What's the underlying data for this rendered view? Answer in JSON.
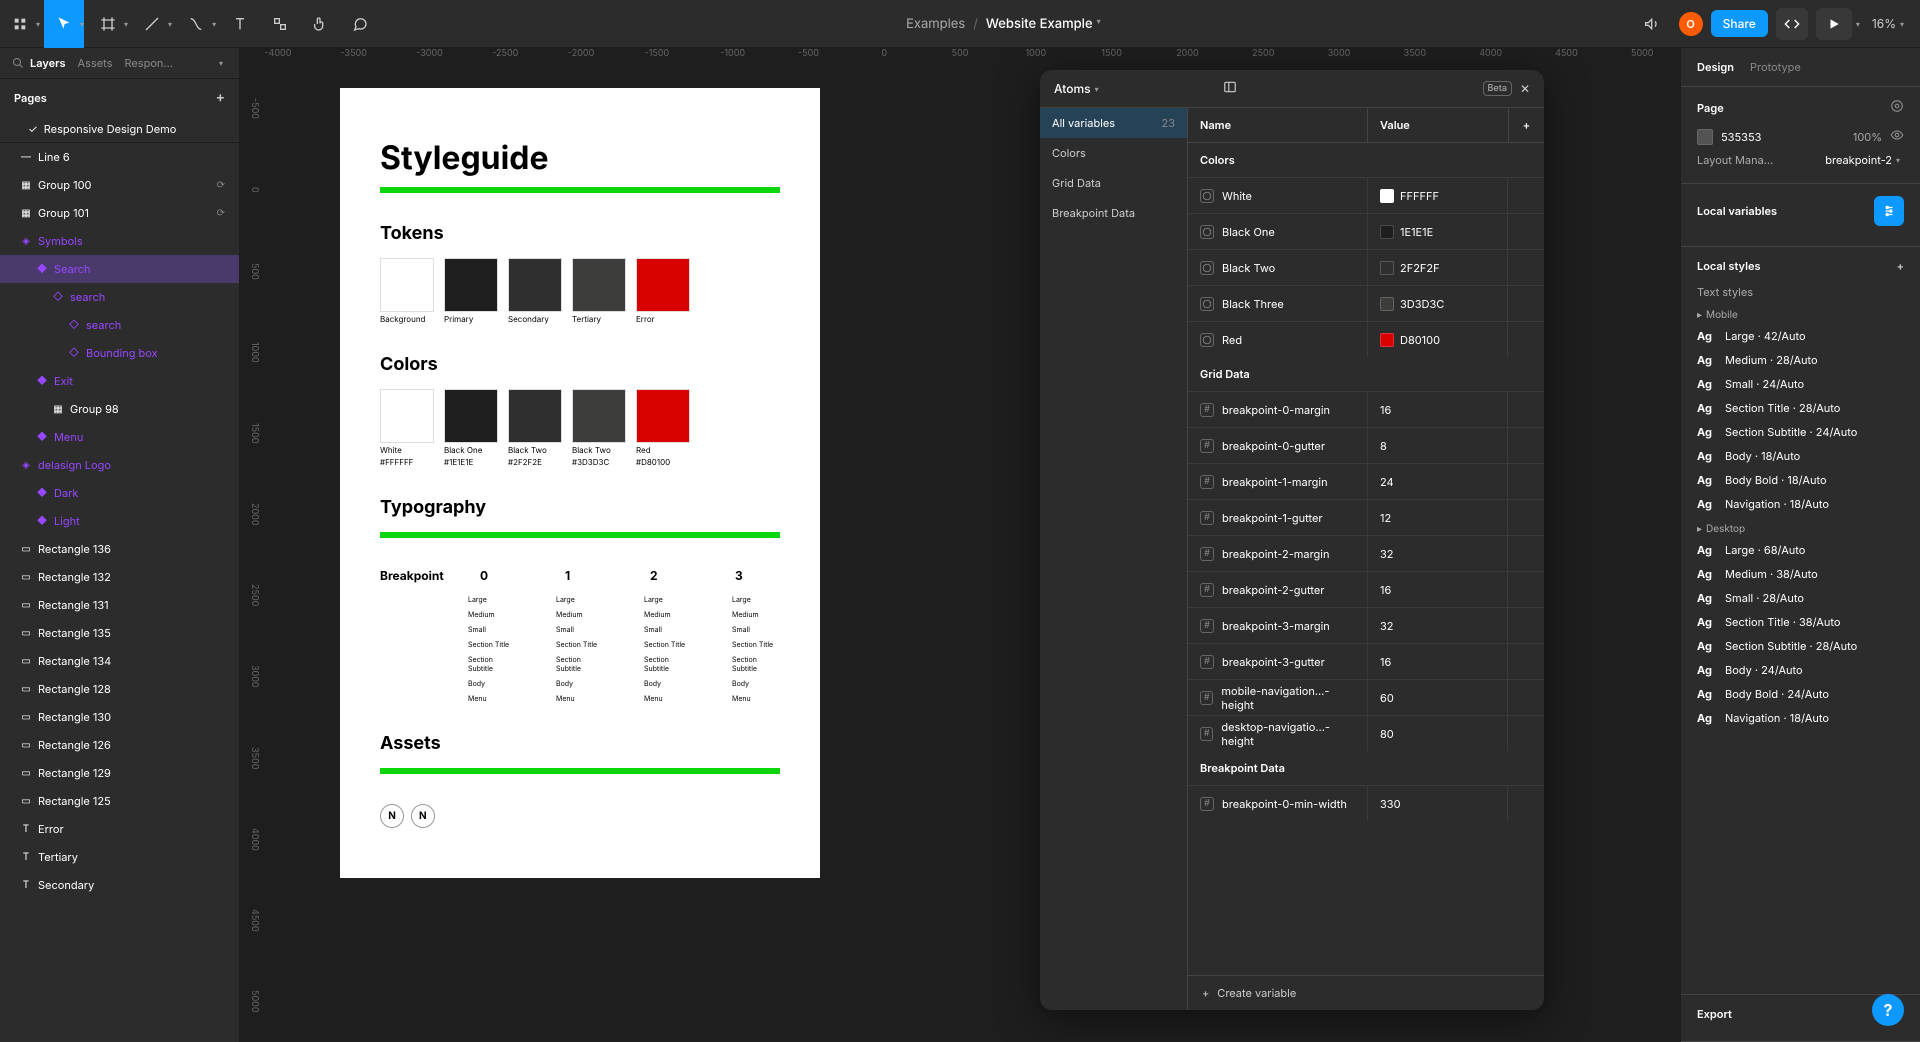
{
  "toolbar": {
    "breadcrumb_project": "Examples",
    "breadcrumb_file": "Website Example",
    "share": "Share",
    "avatar_initial": "O",
    "zoom": "16%"
  },
  "rulers": {
    "h": [
      "-4000",
      "-3500",
      "-3000",
      "-2500",
      "-2000",
      "-1500",
      "-1000",
      "-500",
      "0",
      "500",
      "1000",
      "1500",
      "2000",
      "2500",
      "3000",
      "3500",
      "4000",
      "4500",
      "5000"
    ],
    "v": [
      "-500",
      "0",
      "500",
      "1000",
      "1500",
      "2000",
      "2500",
      "3000",
      "3500",
      "4000",
      "4500",
      "5000"
    ]
  },
  "left_panel": {
    "tabs": [
      "Layers",
      "Assets",
      "Respon…"
    ],
    "active_tab": 0,
    "pages_label": "Pages",
    "active_page": "Responsive Design Demo",
    "layers": [
      {
        "indent": 0,
        "kind": "line",
        "label": "Line 6"
      },
      {
        "indent": 0,
        "kind": "group",
        "label": "Group 100",
        "badge": "⟳"
      },
      {
        "indent": 0,
        "kind": "group",
        "label": "Group 101",
        "badge": "⟳"
      },
      {
        "indent": 0,
        "kind": "comp-set",
        "label": "Symbols",
        "comp": true
      },
      {
        "indent": 1,
        "kind": "comp",
        "label": "Search",
        "comp": true,
        "selected": true
      },
      {
        "indent": 2,
        "kind": "instance",
        "label": "search",
        "comp": true
      },
      {
        "indent": 3,
        "kind": "instance",
        "label": "search",
        "comp": true
      },
      {
        "indent": 3,
        "kind": "instance",
        "label": "Bounding box",
        "comp": true
      },
      {
        "indent": 1,
        "kind": "comp",
        "label": "Exit",
        "comp": true
      },
      {
        "indent": 2,
        "kind": "group",
        "label": "Group 98"
      },
      {
        "indent": 1,
        "kind": "comp",
        "label": "Menu",
        "comp": true
      },
      {
        "indent": 0,
        "kind": "comp-set",
        "label": "delasign Logo",
        "comp": true
      },
      {
        "indent": 1,
        "kind": "comp",
        "label": "Dark",
        "comp": true
      },
      {
        "indent": 1,
        "kind": "comp",
        "label": "Light",
        "comp": true
      },
      {
        "indent": 0,
        "kind": "rect",
        "label": "Rectangle 136"
      },
      {
        "indent": 0,
        "kind": "rect",
        "label": "Rectangle 132"
      },
      {
        "indent": 0,
        "kind": "rect",
        "label": "Rectangle 131"
      },
      {
        "indent": 0,
        "kind": "rect",
        "label": "Rectangle 135"
      },
      {
        "indent": 0,
        "kind": "rect",
        "label": "Rectangle 134"
      },
      {
        "indent": 0,
        "kind": "rect",
        "label": "Rectangle 128"
      },
      {
        "indent": 0,
        "kind": "rect",
        "label": "Rectangle 130"
      },
      {
        "indent": 0,
        "kind": "rect",
        "label": "Rectangle 126"
      },
      {
        "indent": 0,
        "kind": "rect",
        "label": "Rectangle 129"
      },
      {
        "indent": 0,
        "kind": "rect",
        "label": "Rectangle 125"
      },
      {
        "indent": 0,
        "kind": "text",
        "label": "Error"
      },
      {
        "indent": 0,
        "kind": "text",
        "label": "Tertiary"
      },
      {
        "indent": 0,
        "kind": "text",
        "label": "Secondary"
      }
    ]
  },
  "artboard": {
    "title": "Styleguide",
    "tokens_h": "Tokens",
    "token_swatches": [
      {
        "color": "#ffffff",
        "label": "Background"
      },
      {
        "color": "#1e1e1e",
        "label": "Primary"
      },
      {
        "color": "#2f2f2f",
        "label": "Secondary"
      },
      {
        "color": "#3d3d3c",
        "label": "Tertiary"
      },
      {
        "color": "#d80100",
        "label": "Error"
      }
    ],
    "colors_h": "Colors",
    "color_swatches": [
      {
        "color": "#ffffff",
        "label": "White",
        "sub": "#FFFFFF"
      },
      {
        "color": "#1e1e1e",
        "label": "Black One",
        "sub": "#1E1E1E"
      },
      {
        "color": "#2f2f2f",
        "label": "Black Two",
        "sub": "#2F2F2E"
      },
      {
        "color": "#3d3d3c",
        "label": "Black Two",
        "sub": "#3D3D3C"
      },
      {
        "color": "#d80100",
        "label": "Red",
        "sub": "#D80100"
      }
    ],
    "typo_h": "Typography",
    "typo_header": [
      "Breakpoint",
      "0",
      "1",
      "2",
      "3"
    ],
    "typo_rows": [
      [
        "",
        "Large",
        "Large",
        "Large",
        "Large"
      ],
      [
        "",
        "Medium",
        "Medium",
        "Medium",
        "Medium"
      ],
      [
        "",
        "Small",
        "Small",
        "Small",
        "Small"
      ],
      [
        "",
        "Section Title",
        "Section Title",
        "Section Title",
        "Section Title"
      ],
      [
        "",
        "Section Subtitle",
        "Section Subtitle",
        "Section Subtitle",
        "Section Subtitle"
      ],
      [
        "",
        "Body",
        "Body",
        "Body",
        "Body"
      ],
      [
        "",
        "Menu",
        "Menu",
        "Menu",
        "Menu"
      ]
    ],
    "assets_h": "Assets"
  },
  "vars_panel": {
    "title": "Atoms",
    "beta": "Beta",
    "sidebar": [
      {
        "label": "All variables",
        "count": "23",
        "active": true
      },
      {
        "label": "Colors"
      },
      {
        "label": "Grid Data"
      },
      {
        "label": "Breakpoint Data"
      }
    ],
    "col_name": "Name",
    "col_value": "Value",
    "groups": [
      {
        "title": "Colors",
        "rows": [
          {
            "type": "color",
            "name": "White",
            "value": "FFFFFF",
            "swatch": "#ffffff"
          },
          {
            "type": "color",
            "name": "Black One",
            "value": "1E1E1E",
            "swatch": "#1e1e1e"
          },
          {
            "type": "color",
            "name": "Black Two",
            "value": "2F2F2F",
            "swatch": "#2f2f2f"
          },
          {
            "type": "color",
            "name": "Black Three",
            "value": "3D3D3C",
            "swatch": "#3d3d3c"
          },
          {
            "type": "color",
            "name": "Red",
            "value": "D80100",
            "swatch": "#d80100"
          }
        ]
      },
      {
        "title": "Grid Data",
        "rows": [
          {
            "type": "number",
            "name": "breakpoint-0-margin",
            "value": "16"
          },
          {
            "type": "number",
            "name": "breakpoint-0-gutter",
            "value": "8"
          },
          {
            "type": "number",
            "name": "breakpoint-1-margin",
            "value": "24"
          },
          {
            "type": "number",
            "name": "breakpoint-1-gutter",
            "value": "12"
          },
          {
            "type": "number",
            "name": "breakpoint-2-margin",
            "value": "32"
          },
          {
            "type": "number",
            "name": "breakpoint-2-gutter",
            "value": "16"
          },
          {
            "type": "number",
            "name": "breakpoint-3-margin",
            "value": "32"
          },
          {
            "type": "number",
            "name": "breakpoint-3-gutter",
            "value": "16"
          },
          {
            "type": "number",
            "name": "mobile-navigation…-height",
            "value": "60"
          },
          {
            "type": "number",
            "name": "desktop-navigatio…-height",
            "value": "80"
          }
        ]
      },
      {
        "title": "Breakpoint Data",
        "rows": [
          {
            "type": "number",
            "name": "breakpoint-0-min-width",
            "value": "330"
          }
        ]
      }
    ],
    "footer": "Create variable"
  },
  "right_panel": {
    "tabs": [
      "Design",
      "Prototype"
    ],
    "page_label": "Page",
    "bg_hex": "535353",
    "bg_opacity": "100%",
    "layout_label": "Layout Mana…",
    "layout_value": "breakpoint-2",
    "local_vars": "Local variables",
    "local_styles": "Local styles",
    "text_styles_label": "Text styles",
    "style_groups": [
      {
        "name": "Mobile",
        "items": [
          {
            "name": "Large",
            "meta": "42/Auto"
          },
          {
            "name": "Medium",
            "meta": "28/Auto"
          },
          {
            "name": "Small",
            "meta": "24/Auto"
          },
          {
            "name": "Section Title",
            "meta": "28/Auto"
          },
          {
            "name": "Section Subtitle",
            "meta": "24/Auto"
          },
          {
            "name": "Body",
            "meta": "18/Auto"
          },
          {
            "name": "Body Bold",
            "meta": "18/Auto"
          },
          {
            "name": "Navigation",
            "meta": "18/Auto"
          }
        ]
      },
      {
        "name": "Desktop",
        "items": [
          {
            "name": "Large",
            "meta": "68/Auto"
          },
          {
            "name": "Medium",
            "meta": "38/Auto"
          },
          {
            "name": "Small",
            "meta": "28/Auto"
          },
          {
            "name": "Section Title",
            "meta": "38/Auto"
          },
          {
            "name": "Section Subtitle",
            "meta": "28/Auto"
          },
          {
            "name": "Body",
            "meta": "24/Auto"
          },
          {
            "name": "Body Bold",
            "meta": "24/Auto"
          },
          {
            "name": "Navigation",
            "meta": "18/Auto"
          }
        ]
      }
    ],
    "export_label": "Export"
  },
  "help": "?"
}
